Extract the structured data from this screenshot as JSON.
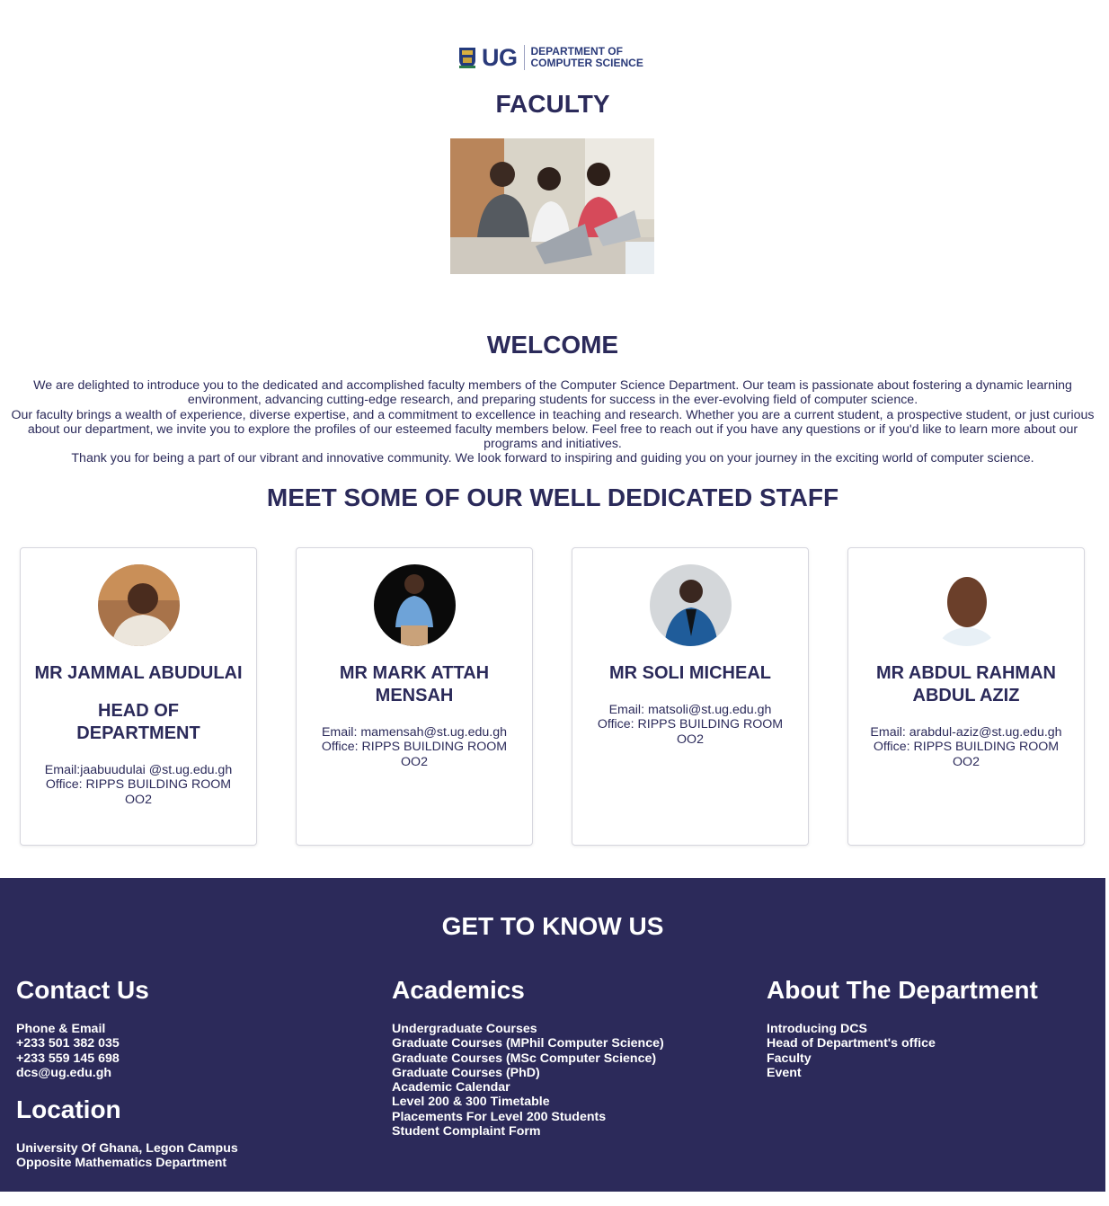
{
  "header": {
    "logo_ug": "UG",
    "logo_line1": "DEPARTMENT OF",
    "logo_line2": "COMPUTER SCIENCE",
    "page_title": "FACULTY"
  },
  "welcome": {
    "title": "WELCOME",
    "paragraphs": [
      "We are delighted to introduce you to the dedicated and accomplished faculty members of the Computer Science Department. Our team is passionate about fostering a dynamic learning environment, advancing cutting-edge research, and preparing students for success in the ever-evolving field of computer science.",
      "Our faculty brings a wealth of experience, diverse expertise, and a commitment to excellence in teaching and research. Whether you are a current student, a prospective student, or just curious about our department, we invite you to explore the profiles of our esteemed faculty members below. Feel free to reach out if you have any questions or if you'd like to learn more about our programs and initiatives.",
      "Thank you for being a part of our vibrant and innovative community. We look forward to inspiring and guiding you on your journey in the exciting world of computer science."
    ]
  },
  "staff": {
    "title": "MEET SOME OF OUR WELL DEDICATED STAFF",
    "members": [
      {
        "name": "MR JAMMAL ABUDULAI",
        "role": "HEAD OF DEPARTMENT",
        "email": "Email:jaabuudulai @st.ug.edu.gh",
        "office": "Office: RIPPS BUILDING ROOM OO2"
      },
      {
        "name": "MR MARK ATTAH MENSAH",
        "email": "Email: mamensah@st.ug.edu.gh",
        "office": "Office: RIPPS BUILDING ROOM OO2"
      },
      {
        "name": "MR SOLI MICHEAL",
        "email": "Email: matsoli@st.ug.edu.gh",
        "office": "Office: RIPPS BUILDING ROOM OO2"
      },
      {
        "name": "MR ABDUL RAHMAN ABDUL AZIZ",
        "email": "Email: arabdul-aziz@st.ug.edu.gh",
        "office": "Office: RIPPS BUILDING ROOM OO2"
      }
    ]
  },
  "footer": {
    "title": "GET TO KNOW US",
    "contact": {
      "heading": "Contact Us",
      "label": "Phone & Email",
      "phone1": "+233 501 382 035",
      "phone2": "+233 559 145 698",
      "email": "dcs@ug.edu.gh"
    },
    "location": {
      "heading": "Location",
      "line1": "University Of Ghana, Legon Campus",
      "line2": "Opposite Mathematics Department"
    },
    "academics": {
      "heading": "Academics",
      "links": [
        "Undergraduate Courses",
        "Graduate Courses (MPhil Computer Science)",
        "Graduate Courses (MSc Computer Science)",
        "Graduate Courses (PhD)",
        "Academic Calendar",
        "Level 200 & 300 Timetable",
        "Placements For Level 200 Students",
        "Student Complaint Form"
      ]
    },
    "about": {
      "heading": "About The Department",
      "links": [
        "Introducing DCS",
        "Head of Department's office",
        "Faculty",
        "Event"
      ]
    }
  },
  "colors": {
    "primary": "#2c2a5a",
    "logo_blue": "#2a3a7a",
    "text_on_dark": "#ffffff"
  }
}
